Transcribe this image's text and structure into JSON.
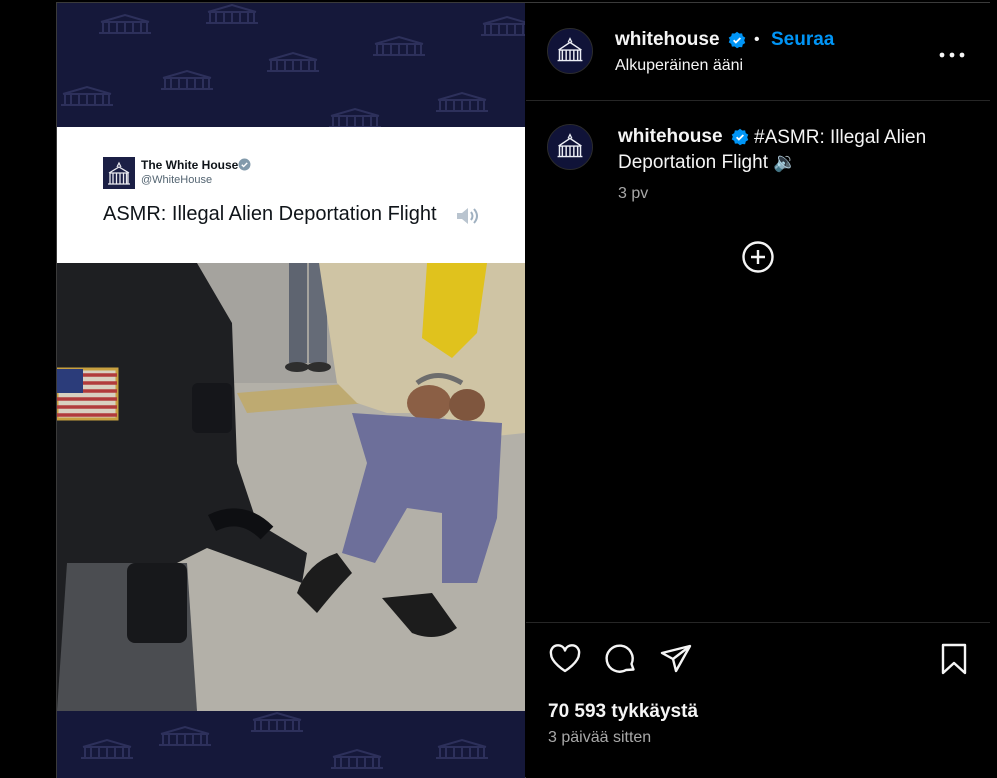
{
  "post": {
    "username": "whitehouse",
    "dot": "•",
    "follow_label": "Seuraa",
    "audio_label": "Alkuperäinen ääni",
    "caption_username": "whitehouse",
    "caption_text": "#ASMR: Illegal Alien Deportation Flight 🔉",
    "caption_age": "3 pv",
    "likes": "70 593 tykkäystä",
    "posted": "3 päivää sitten"
  },
  "media": {
    "tweet_name": "The White House",
    "tweet_handle": "@WhiteHouse",
    "tweet_text": "ASMR: Illegal Alien Deportation Flight"
  },
  "icons": {
    "verified": "verified-badge-icon",
    "more": "more-options-icon",
    "add": "add-circle-icon",
    "like": "heart-icon",
    "comment": "comment-icon",
    "share": "share-icon",
    "save": "bookmark-icon"
  },
  "colors": {
    "accent": "#0095f6",
    "background": "#000000",
    "media_background": "#15183a"
  }
}
